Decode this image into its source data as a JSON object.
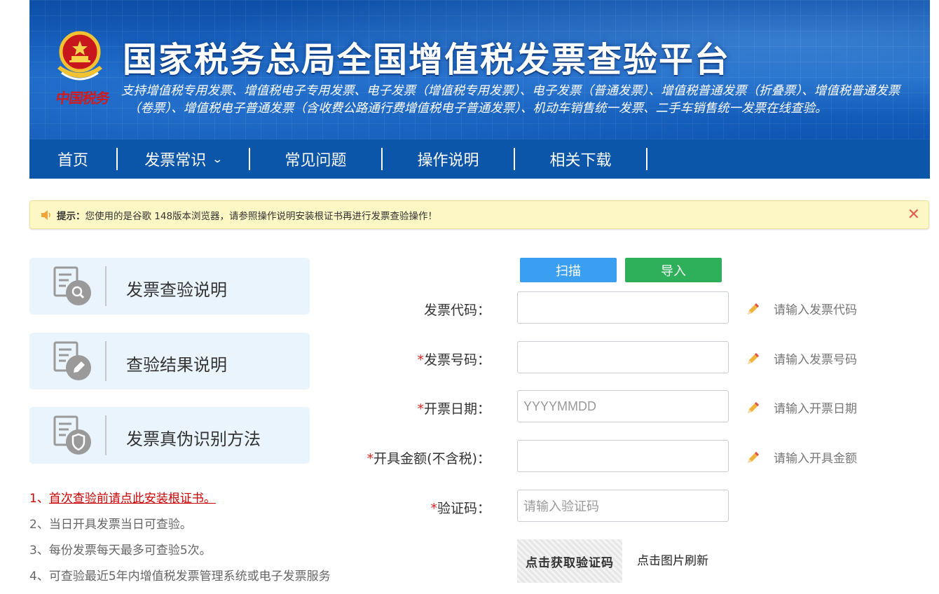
{
  "header": {
    "title": "国家税务总局全国增值税发票查验平台",
    "seal_text": "中国税务",
    "subtitle_line1": "支持增值税专用发票、增值税电子专用发票、电子发票（增值税专用发票）、电子发票（普通发票）、增值税普通发票（折叠票）、增值税普通发票",
    "subtitle_line2": "（卷票）、增值税电子普通发票（含收费公路通行费增值税电子普通发票）、机动车销售统一发票、二手车销售统一发票在线查验。"
  },
  "nav": {
    "items": [
      {
        "label": "首页"
      },
      {
        "label": "发票常识",
        "icon": "chevron-down-icon"
      },
      {
        "label": "常见问题"
      },
      {
        "label": "操作说明"
      },
      {
        "label": "相关下载"
      }
    ]
  },
  "notice": {
    "label": "提示：",
    "text": "您使用的是谷歌 148版本浏览器，请参照操作说明安装根证书再进行发票查验操作！",
    "icons": [
      "speaker-icon",
      "close-icon"
    ]
  },
  "cards": [
    {
      "title": "发票查验说明",
      "icon": "document-search-icon"
    },
    {
      "title": "查验结果说明",
      "icon": "document-edit-icon"
    },
    {
      "title": "发票真伪识别方法",
      "icon": "document-shield-icon"
    }
  ],
  "notes": {
    "item1_prefix": "1、",
    "item1_link": "首次查验前请点此安装根证书。",
    "item2": "2、当日开具发票当日可查验。",
    "item3": "3、每份发票每天最多可查验5次。",
    "item4": "4、可查验最近5年内增值税发票管理系统或电子发票服务"
  },
  "actions": {
    "scan_label": "扫描",
    "import_label": "导入"
  },
  "form": {
    "invoice_code": {
      "label": "发票代码：",
      "required": false,
      "value": "",
      "placeholder": "",
      "hint": "请输入发票代码"
    },
    "invoice_number": {
      "label": "发票号码：",
      "required": true,
      "value": "",
      "placeholder": "",
      "hint": "请输入发票号码"
    },
    "invoice_date": {
      "label": "开票日期：",
      "required": true,
      "value": "",
      "placeholder": "YYYYMMDD",
      "hint": "请输入开票日期"
    },
    "amount": {
      "label": "开具金额(不含税)：",
      "required": true,
      "value": "",
      "placeholder": "",
      "hint": "请输入开具金额"
    },
    "captcha": {
      "label": "验证码：",
      "required": true,
      "value": "",
      "placeholder": "请输入验证码"
    },
    "captcha_image_text": "点击获取验证码",
    "refresh_text": "点击图片刷新",
    "required_mark": "*"
  },
  "colors": {
    "nav_bg": "#0b56a8",
    "scan_button": "#3a9ff0",
    "import_button": "#2eb05a",
    "required_star": "#e0251f",
    "notice_bg": "#fdf6c5",
    "card_bg": "#eaf4fd"
  }
}
